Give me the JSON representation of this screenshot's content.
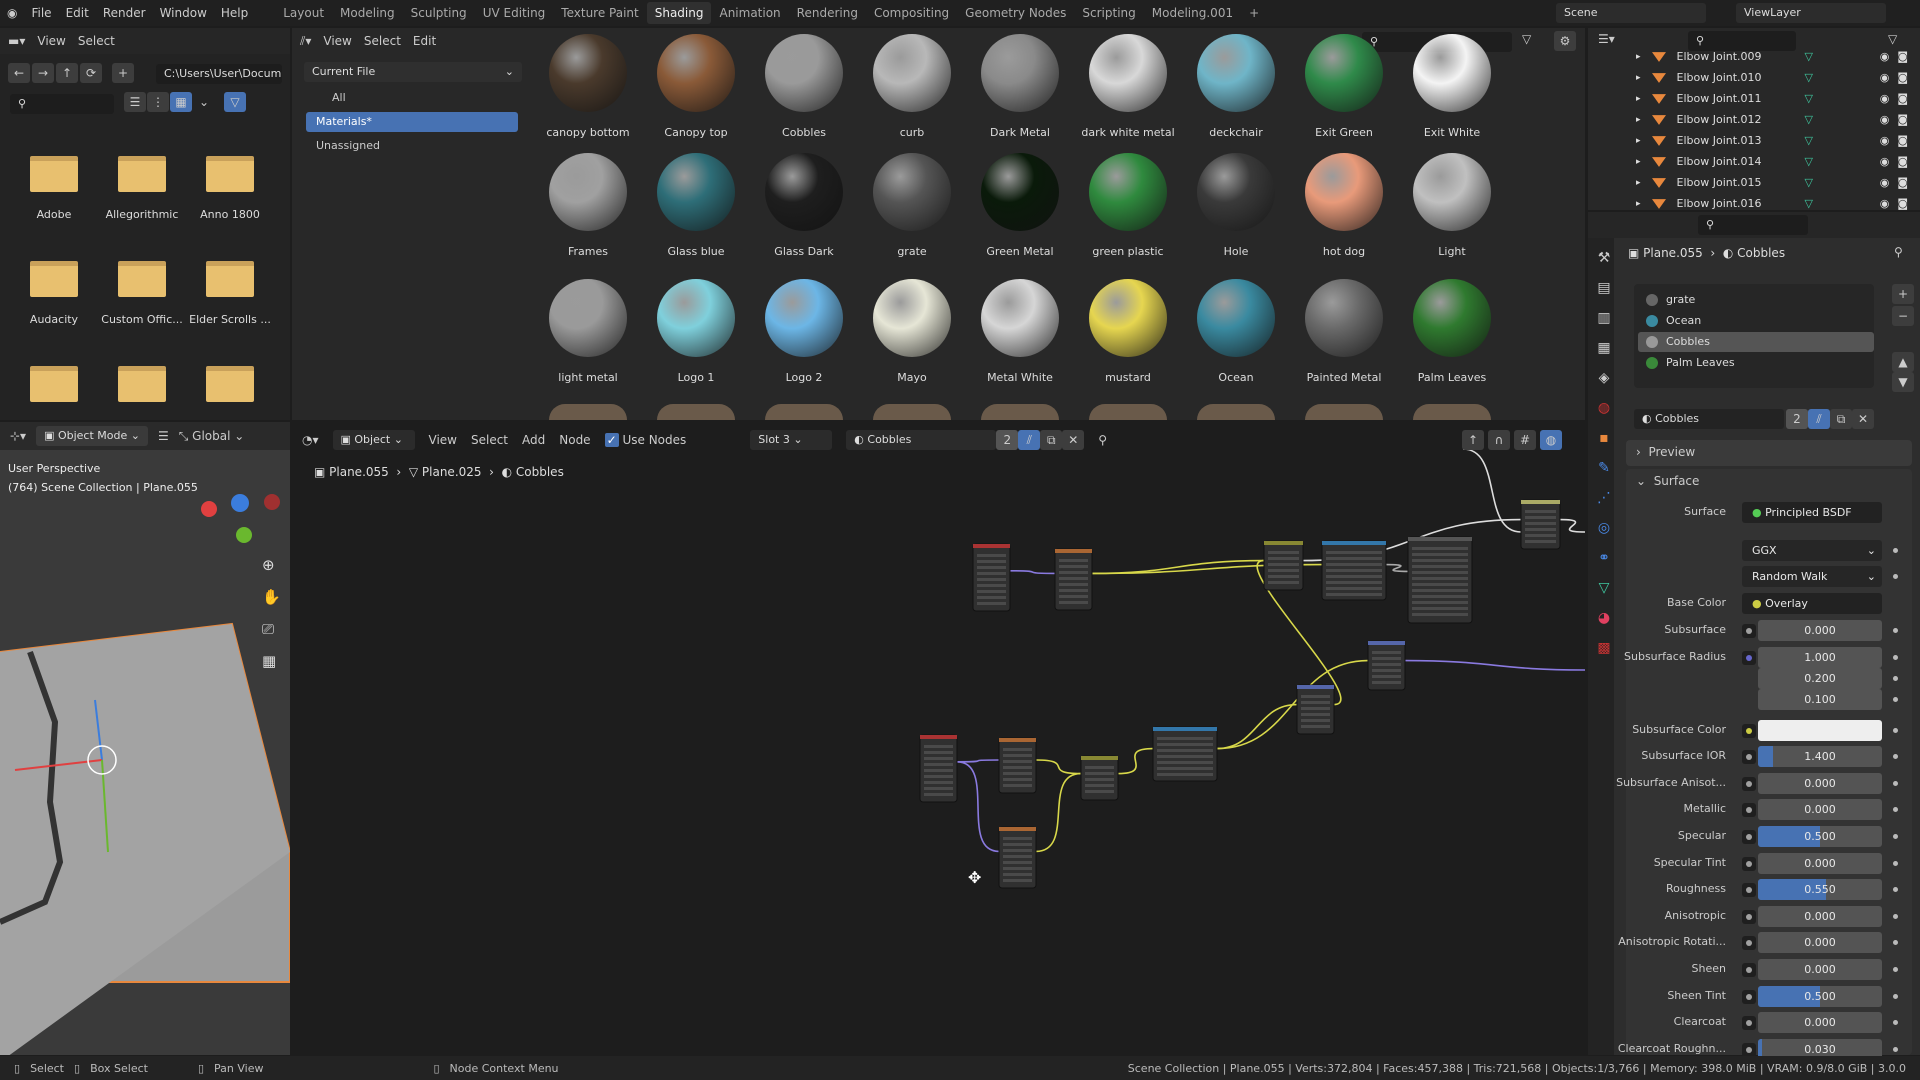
{
  "topbar": {
    "menus": [
      "File",
      "Edit",
      "Render",
      "Window",
      "Help"
    ],
    "workspaces": [
      "Layout",
      "Modeling",
      "Sculpting",
      "UV Editing",
      "Texture Paint",
      "Shading",
      "Animation",
      "Rendering",
      "Compositing",
      "Geometry Nodes",
      "Scripting",
      "Modeling.001"
    ],
    "active_workspace": "Shading",
    "add_tab": "+",
    "scene": "Scene",
    "view_layer": "ViewLayer"
  },
  "file_browser": {
    "menus": [
      "View",
      "Select"
    ],
    "path": "C:\\Users\\User\\Docum...",
    "folders": [
      "Adobe",
      "Allegorithmic",
      "Anno 1800",
      "Audacity",
      "Custom Offic...",
      "Elder Scrolls ...",
      "",
      "",
      ""
    ]
  },
  "asset_browser": {
    "menus": [
      "View",
      "Select",
      "Edit"
    ],
    "library": "Current File",
    "categories": [
      {
        "label": "All"
      },
      {
        "label": "Materials*",
        "selected": true
      },
      {
        "label": "Unassigned"
      }
    ],
    "materials": [
      {
        "name": "canopy bottom",
        "color": "#4a3a2c"
      },
      {
        "name": "Canopy top",
        "color": "#8a5a38"
      },
      {
        "name": "Cobbles",
        "color": "#9a9a9a"
      },
      {
        "name": "curb",
        "color": "#b8b8b8"
      },
      {
        "name": "Dark Metal",
        "color": "#8a8a8a"
      },
      {
        "name": "dark white metal",
        "color": "#d8d8d8"
      },
      {
        "name": "deckchair",
        "color": "#6fb5c8"
      },
      {
        "name": "Exit Green",
        "color": "#2f8a4a"
      },
      {
        "name": "Exit White",
        "color": "#f4f4f4"
      },
      {
        "name": "Frames",
        "color": "#a0a0a0"
      },
      {
        "name": "Glass blue",
        "color": "#2e6e78"
      },
      {
        "name": "Glass Dark",
        "color": "#1e1e1e"
      },
      {
        "name": "grate",
        "color": "#555555"
      },
      {
        "name": "Green Metal",
        "color": "#0a1a0a"
      },
      {
        "name": "green plastic",
        "color": "#2f8a3e"
      },
      {
        "name": "Hole",
        "color": "#3a3a3a"
      },
      {
        "name": "hot dog",
        "color": "#e89a7a"
      },
      {
        "name": "Light",
        "color": "#c0c0c0"
      },
      {
        "name": "light metal",
        "color": "#9a9a9a"
      },
      {
        "name": "Logo 1",
        "color": "#7fd0dc"
      },
      {
        "name": "Logo 2",
        "color": "#6cb6e6"
      },
      {
        "name": "Mayo",
        "color": "#e6e6d6"
      },
      {
        "name": "Metal White",
        "color": "#d6d6d6"
      },
      {
        "name": "mustard",
        "color": "#e6d650"
      },
      {
        "name": "Ocean",
        "color": "#3a8aa0"
      },
      {
        "name": "Painted Metal",
        "color": "#6a6a6a"
      },
      {
        "name": "Palm Leaves",
        "color": "#2f7a2f"
      }
    ]
  },
  "outliner": {
    "items": [
      "Elbow Joint.009",
      "Elbow Joint.010",
      "Elbow Joint.011",
      "Elbow Joint.012",
      "Elbow Joint.013",
      "Elbow Joint.014",
      "Elbow Joint.015",
      "Elbow Joint.016"
    ]
  },
  "viewport": {
    "mode": "Object Mode",
    "orientation": "Global",
    "view_name": "User Perspective",
    "collection_info": "(764) Scene Collection | Plane.055"
  },
  "node_editor": {
    "object_menu": "Object",
    "menus": [
      "View",
      "Select",
      "Add",
      "Node"
    ],
    "use_nodes_label": "Use Nodes",
    "use_nodes": true,
    "slot": "Slot 3",
    "material": "Cobbles",
    "users": "2",
    "breadcrumb": [
      "Plane.055",
      "Plane.025",
      "Cobbles"
    ]
  },
  "properties": {
    "breadcrumb": [
      "Plane.055",
      "Cobbles"
    ],
    "slots": [
      {
        "name": "grate",
        "color": "#666"
      },
      {
        "name": "Ocean",
        "color": "#3a8aa0"
      },
      {
        "name": "Cobbles",
        "color": "#999",
        "selected": true
      },
      {
        "name": "Palm Leaves",
        "color": "#3a8a3a"
      }
    ],
    "material": "Cobbles",
    "users": "2",
    "sections": {
      "preview": "Preview",
      "surface": "Surface"
    },
    "surface_label": "Surface",
    "surface_shader": "Principled BSDF",
    "distribution": "GGX",
    "subsurface_method": "Random Walk",
    "base_color_label": "Base Color",
    "base_color_input": "Overlay",
    "fields": [
      {
        "label": "Subsurface",
        "value": "0.000",
        "fraction": 0
      },
      {
        "label": "Subsurface Radius",
        "value": "1.000",
        "extra": [
          "0.200",
          "0.100"
        ]
      },
      {
        "label": "Subsurface Color",
        "color": "#eeeeee"
      },
      {
        "label": "Subsurface IOR",
        "value": "1.400",
        "fraction": 0.12
      },
      {
        "label": "Subsurface Anisot...",
        "value": "0.000",
        "fraction": 0
      },
      {
        "label": "Metallic",
        "value": "0.000",
        "fraction": 0
      },
      {
        "label": "Specular",
        "value": "0.500",
        "fraction": 0.5
      },
      {
        "label": "Specular Tint",
        "value": "0.000",
        "fraction": 0
      },
      {
        "label": "Roughness",
        "value": "0.550",
        "fraction": 0.55
      },
      {
        "label": "Anisotropic",
        "value": "0.000",
        "fraction": 0
      },
      {
        "label": "Anisotropic Rotati...",
        "value": "0.000",
        "fraction": 0
      },
      {
        "label": "Sheen",
        "value": "0.000",
        "fraction": 0
      },
      {
        "label": "Sheen Tint",
        "value": "0.500",
        "fraction": 0.5
      },
      {
        "label": "Clearcoat",
        "value": "0.000",
        "fraction": 0
      },
      {
        "label": "Clearcoat Roughn...",
        "value": "0.030",
        "fraction": 0.03
      }
    ]
  },
  "statusbar": {
    "select": "Select",
    "box_select": "Box Select",
    "pan_view": "Pan View",
    "context_menu": "Node Context Menu",
    "stats": "Scene Collection | Plane.055 | Verts:372,804 | Faces:457,388 | Tris:721,568 | Objects:1/3,766 | Memory: 398.0 MiB | VRAM: 0.9/8.0 GiB | 3.0.0"
  },
  "colors": {
    "accent": "#4772b3",
    "folder": "#e8c06f",
    "object_orange": "#e8883d",
    "mesh_teal": "#3fc9a0"
  }
}
